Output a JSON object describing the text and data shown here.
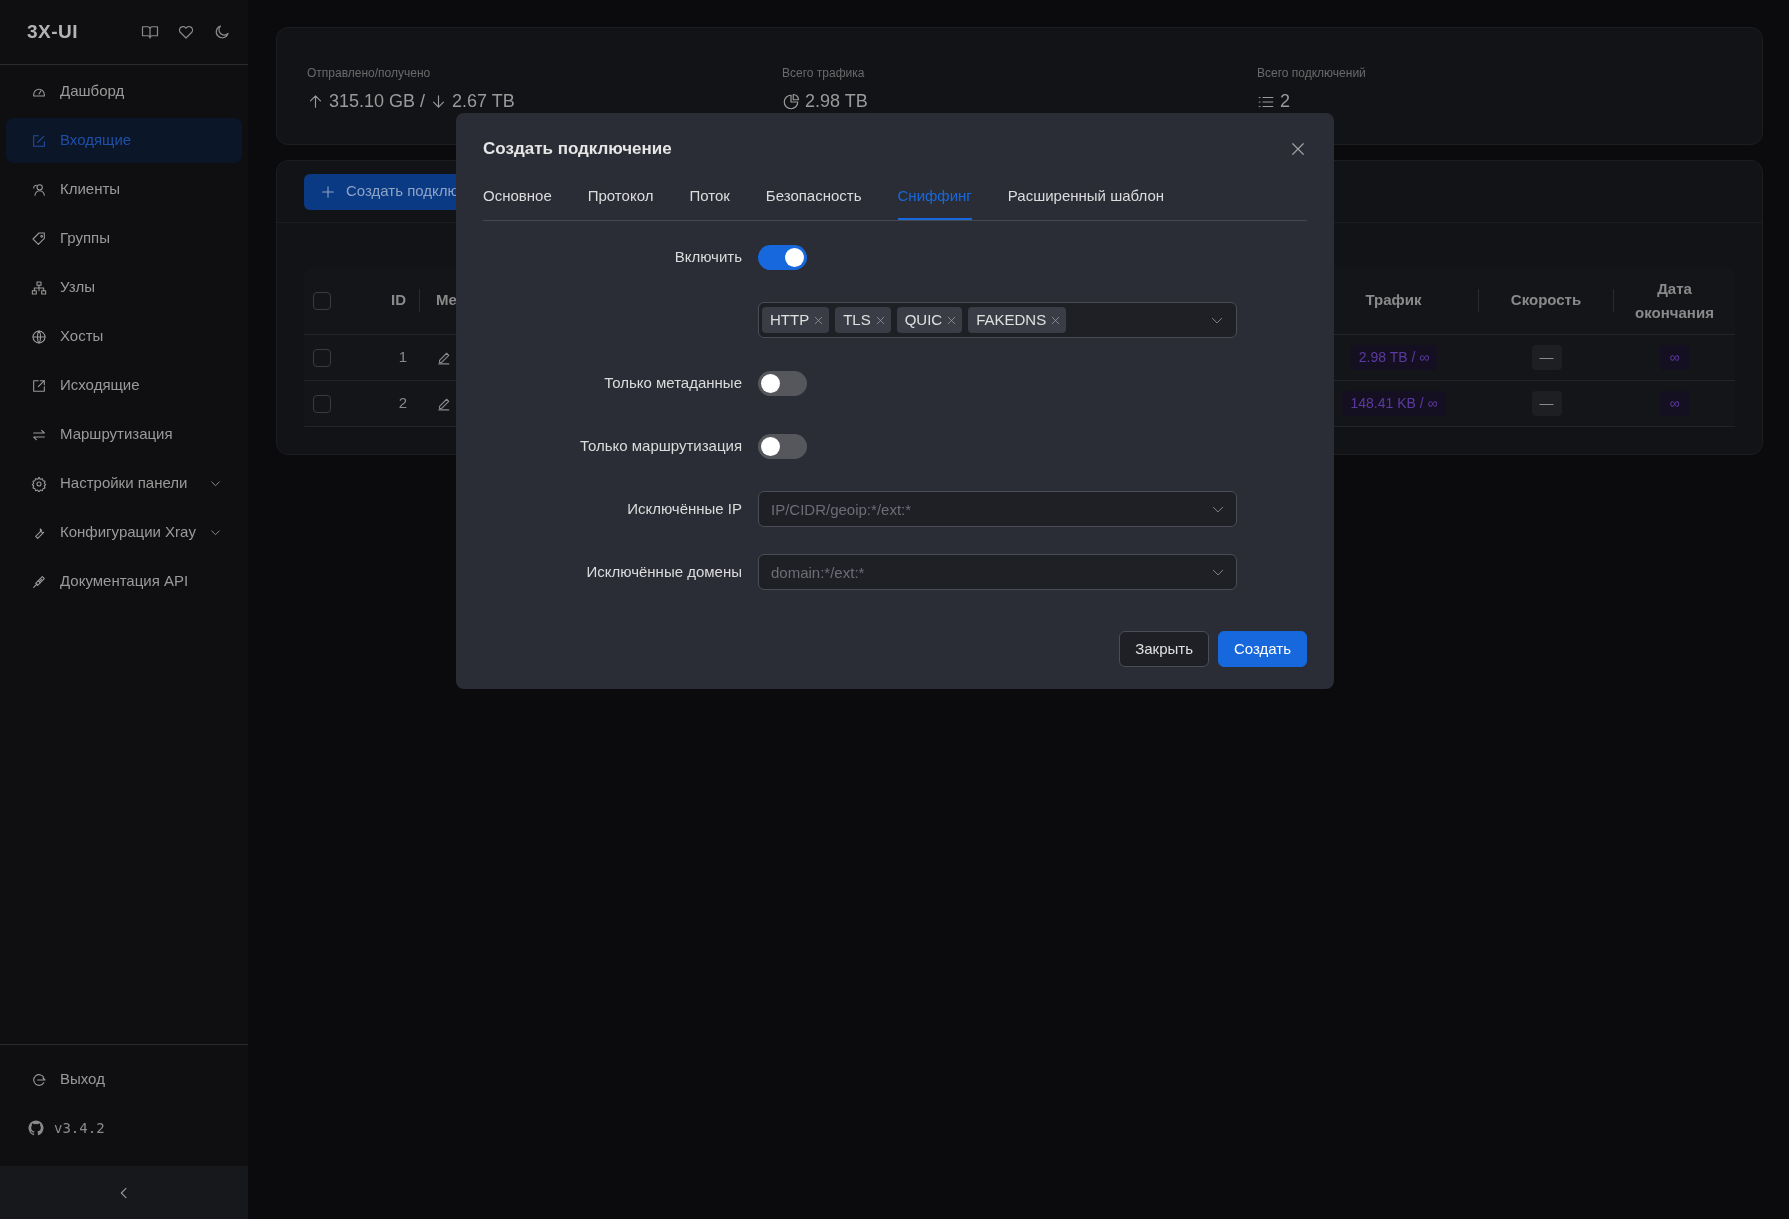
{
  "sidebar": {
    "logo": "3X-UI",
    "items": [
      {
        "label": "Дашборд",
        "kind": "link",
        "selected": false
      },
      {
        "label": "Входящие",
        "kind": "link",
        "selected": true
      },
      {
        "label": "Клиенты",
        "kind": "link",
        "selected": false
      },
      {
        "label": "Группы",
        "kind": "link",
        "selected": false
      },
      {
        "label": "Узлы",
        "kind": "link",
        "selected": false
      },
      {
        "label": "Хосты",
        "kind": "link",
        "selected": false
      },
      {
        "label": "Исходящие",
        "kind": "link",
        "selected": false
      },
      {
        "label": "Маршрутизация",
        "kind": "link",
        "selected": false
      },
      {
        "label": "Настройки панели",
        "kind": "submenu",
        "selected": false
      },
      {
        "label": "Конфигурации Xray",
        "kind": "submenu",
        "selected": false
      },
      {
        "label": "Документация API",
        "kind": "link",
        "selected": false
      }
    ],
    "logout": "Выход",
    "version": "v3.4.2"
  },
  "stats": [
    {
      "label": "Отправлено/получено",
      "kind": "updown",
      "values": [
        "315.10 GB",
        "2.67 TB"
      ],
      "separator": "/"
    },
    {
      "label": "Всего трафика",
      "kind": "total",
      "values": [
        "2.98 TB"
      ]
    },
    {
      "label": "Всего подключений",
      "kind": "count",
      "values": [
        "2"
      ]
    }
  ],
  "inbounds": {
    "add_button": "Создать подклю",
    "all_checked": false,
    "columns": [
      "ID",
      "Ме",
      "Трафик",
      "Скорость",
      "Дата окончания"
    ],
    "rows": [
      {
        "id": "1",
        "traffic": "2.98 TB / ∞",
        "speed": "—",
        "expiry": "∞",
        "checked": false
      },
      {
        "id": "2",
        "traffic": "148.41 KB / ∞",
        "speed": "—",
        "expiry": "∞",
        "checked": false
      }
    ]
  },
  "modal": {
    "title": "Создать подключение",
    "tabs": [
      {
        "label": "Основное",
        "selected": false
      },
      {
        "label": "Протокол",
        "selected": false
      },
      {
        "label": "Поток",
        "selected": false
      },
      {
        "label": "Безопасность",
        "selected": false
      },
      {
        "label": "Сниффинг",
        "selected": true
      },
      {
        "label": "Расширенный шаблон",
        "selected": false
      }
    ],
    "fields": [
      {
        "kind": "toggle",
        "label": "Включить",
        "on": true
      },
      {
        "kind": "tags",
        "tags": [
          "HTTP",
          "TLS",
          "QUIC",
          "FAKEDNS"
        ]
      },
      {
        "kind": "toggle",
        "label": "Только метаданные",
        "on": false
      },
      {
        "kind": "toggle",
        "label": "Только маршрутизация",
        "on": false
      },
      {
        "kind": "select",
        "label": "Исключённые IP",
        "placeholder": "IP/CIDR/geoip:*/ext:*"
      },
      {
        "kind": "select",
        "label": "Исключённые домены",
        "placeholder": "domain:*/ext:*"
      }
    ],
    "buttons": [
      {
        "label": "Закрыть",
        "kind": "secondary"
      },
      {
        "label": "Создать",
        "kind": "primary"
      }
    ]
  }
}
